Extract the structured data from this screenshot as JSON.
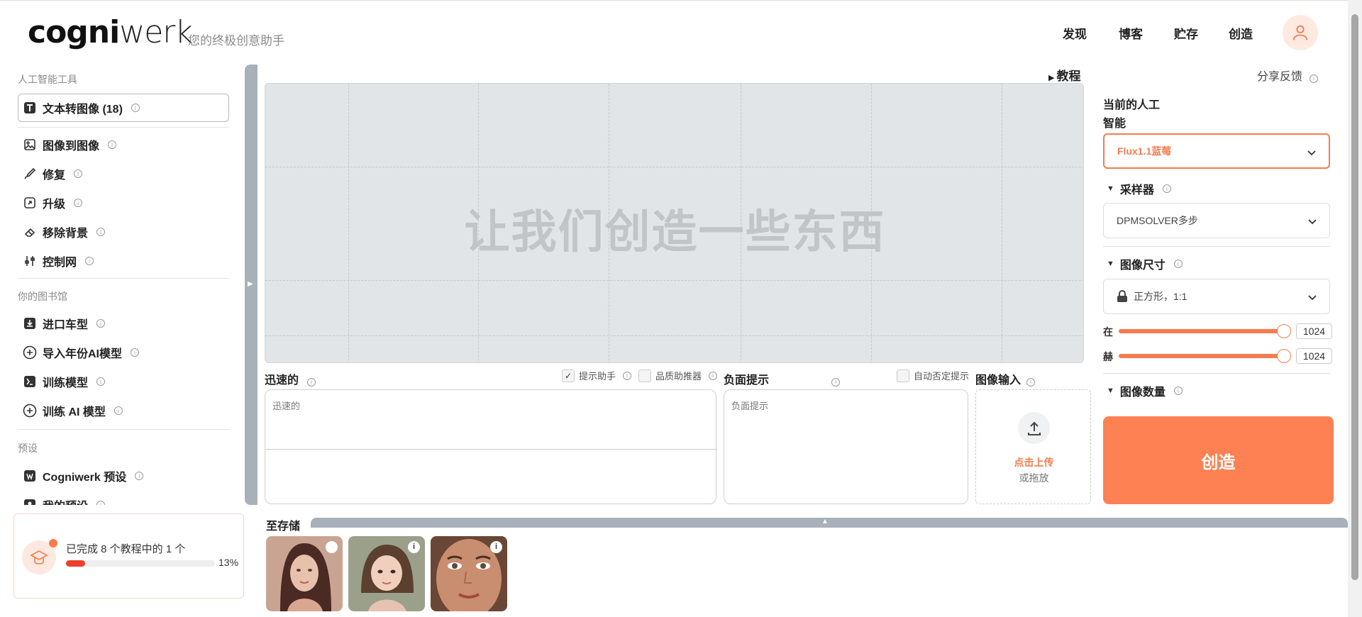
{
  "header": {
    "logo_bold": "cogni",
    "logo_thin": "werk",
    "tagline": "您的终极创意助手",
    "nav": [
      "发现",
      "博客",
      "贮存",
      "创造"
    ]
  },
  "sidebar": {
    "section_tools": "人工智能工具",
    "tools": [
      {
        "label": "文本转图像 (18)",
        "icon": "text-image-icon"
      },
      {
        "label": "图像到图像",
        "icon": "image-icon"
      },
      {
        "label": "修复",
        "icon": "brush-icon"
      },
      {
        "label": "升级",
        "icon": "upscale-icon"
      },
      {
        "label": "移除背景",
        "icon": "eraser-icon"
      },
      {
        "label": "控制网",
        "icon": "sliders-icon"
      }
    ],
    "section_library": "你的图书馆",
    "library": [
      {
        "label": "进口车型",
        "icon": "import-icon"
      },
      {
        "label": "导入年份AI模型",
        "icon": "plus-circle-icon"
      },
      {
        "label": "训练模型",
        "icon": "train-icon"
      },
      {
        "label": "训练 AI 模型",
        "icon": "plus-circle-icon"
      }
    ],
    "section_presets": "预设",
    "presets": [
      {
        "label": "Cogniwerk 预设",
        "icon": "cogniwerk-icon"
      },
      {
        "label": "我的预设",
        "icon": "user-icon"
      }
    ],
    "progress": {
      "text": "已完成 8 个教程中的 1 个",
      "percent_label": "13%",
      "percent": 13
    }
  },
  "canvas": {
    "tutorial": "教程",
    "placeholder": "让我们创造一些东西"
  },
  "prompt": {
    "label": "迅速的",
    "placeholder": "迅速的",
    "assistant": "提示助手",
    "quality": "品质助推器"
  },
  "negative": {
    "label": "负面提示",
    "placeholder": "负面提示",
    "auto": "自动否定提示"
  },
  "image_input": {
    "label": "图像输入",
    "upload": "点击上传",
    "drag": "或拖放"
  },
  "right": {
    "feedback": "分享反馈",
    "current_ai_line1": "当前的人工",
    "current_ai_line2": "智能",
    "model": "Flux1.1蓝莓",
    "sampler_label": "采样器",
    "sampler": "DPMSOLVER多步",
    "size_label": "图像尺寸",
    "size": "正方形，1:1",
    "width_label": "在",
    "width_value": "1024",
    "height_label": "赫",
    "height_value": "1024",
    "count_label": "图像数量",
    "create": "创造",
    "accent": "#fd8152"
  },
  "storage": {
    "label": "至存储",
    "info": "i"
  }
}
